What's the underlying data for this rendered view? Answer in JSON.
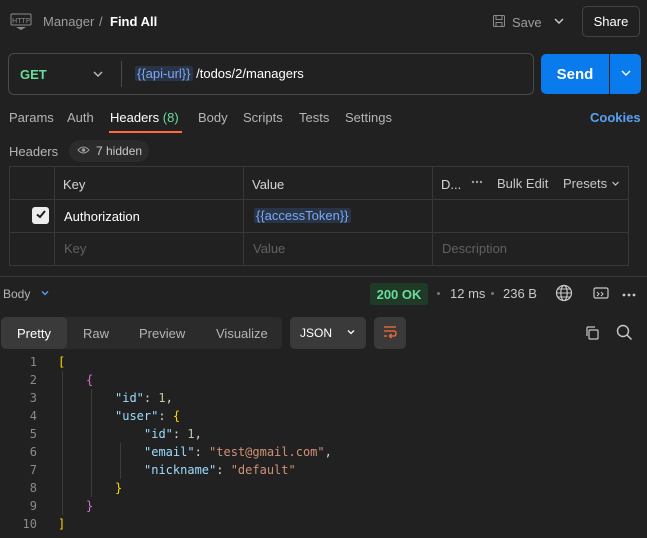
{
  "header": {
    "collection": "Manager",
    "separator": "/",
    "request_name": "Find All",
    "save_label": "Save",
    "share_label": "Share"
  },
  "request": {
    "method": "GET",
    "url_variable": "{{api-url}}",
    "url_path": "/todos/2/managers",
    "send_label": "Send"
  },
  "tabs": [
    {
      "label": "Params"
    },
    {
      "label": "Auth"
    },
    {
      "label": "Headers",
      "count": "(8)"
    },
    {
      "label": "Body"
    },
    {
      "label": "Scripts"
    },
    {
      "label": "Tests"
    },
    {
      "label": "Settings"
    }
  ],
  "cookies_label": "Cookies",
  "headers_section": {
    "title": "Headers",
    "hidden_label": "7 hidden",
    "columns": {
      "key": "Key",
      "value": "Value",
      "description": "D...",
      "bulk_edit": "Bulk Edit",
      "presets": "Presets"
    },
    "rows": [
      {
        "checked": true,
        "key": "Authorization",
        "value": "{{accessToken}}"
      }
    ],
    "placeholders": {
      "key": "Key",
      "value": "Value",
      "description": "Description"
    }
  },
  "response": {
    "body_label": "Body",
    "status": "200 OK",
    "time": "12 ms",
    "size": "236 B",
    "view_tabs": [
      "Pretty",
      "Raw",
      "Preview",
      "Visualize"
    ],
    "active_view": "Pretty",
    "format": "JSON",
    "line_numbers": [
      "1",
      "2",
      "3",
      "4",
      "5",
      "6",
      "7",
      "8",
      "9",
      "10"
    ],
    "code": {
      "id_key": "\"id\"",
      "id_val": "1",
      "user_key": "\"user\"",
      "email_key": "\"email\"",
      "email_val": "\"test@gmail.com\"",
      "nickname_key": "\"nickname\"",
      "nickname_val": "\"default\""
    }
  },
  "colors": {
    "send": "#097bed",
    "method": "#6bdd9a",
    "accent": "#ff6c37",
    "link": "#5aa1f5"
  }
}
